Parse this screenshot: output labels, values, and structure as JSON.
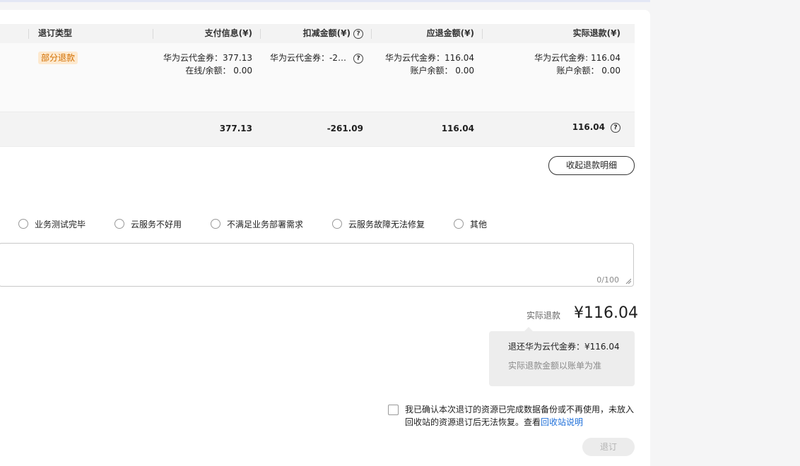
{
  "table": {
    "headers": {
      "type": "退订类型",
      "payment": "支付信息(¥)",
      "deduct": "扣减金额(¥)",
      "due": "应退金额(¥)",
      "actual": "实际退款(¥)"
    },
    "row": {
      "type_tag": "部分退款",
      "payment_line1": "华为云代金券：377.13",
      "payment_line2": "在线/余额：  0.00",
      "deduct_line1": "华为云代金券：-2…",
      "due_line1": "华为云代金券：116.04",
      "due_line2": "账户余额：  0.00",
      "actual_line1": "华为云代金券: 116.04",
      "actual_line2": "账户余额：  0.00"
    },
    "summary": {
      "payment": "377.13",
      "deduct": "-261.09",
      "due": "116.04",
      "actual": "116.04"
    }
  },
  "collapse_button": "收起退款明细",
  "reasons": [
    "业务测试完毕",
    "云服务不好用",
    "不满足业务部署需求",
    "云服务故障无法修复",
    "其他"
  ],
  "remark": {
    "counter": "0/100"
  },
  "refund": {
    "label": "实际退款",
    "amount": "¥116.04",
    "tip_line1": "退还华为云代金券：¥116.04",
    "tip_line2": "实际退款金额以账单为准"
  },
  "confirm": {
    "text": "我已确认本次退订的资源已完成数据备份或不再使用，未放入回收站的资源退订后无法恢复。查看",
    "link": "回收站说明"
  },
  "submit_button": "退订"
}
